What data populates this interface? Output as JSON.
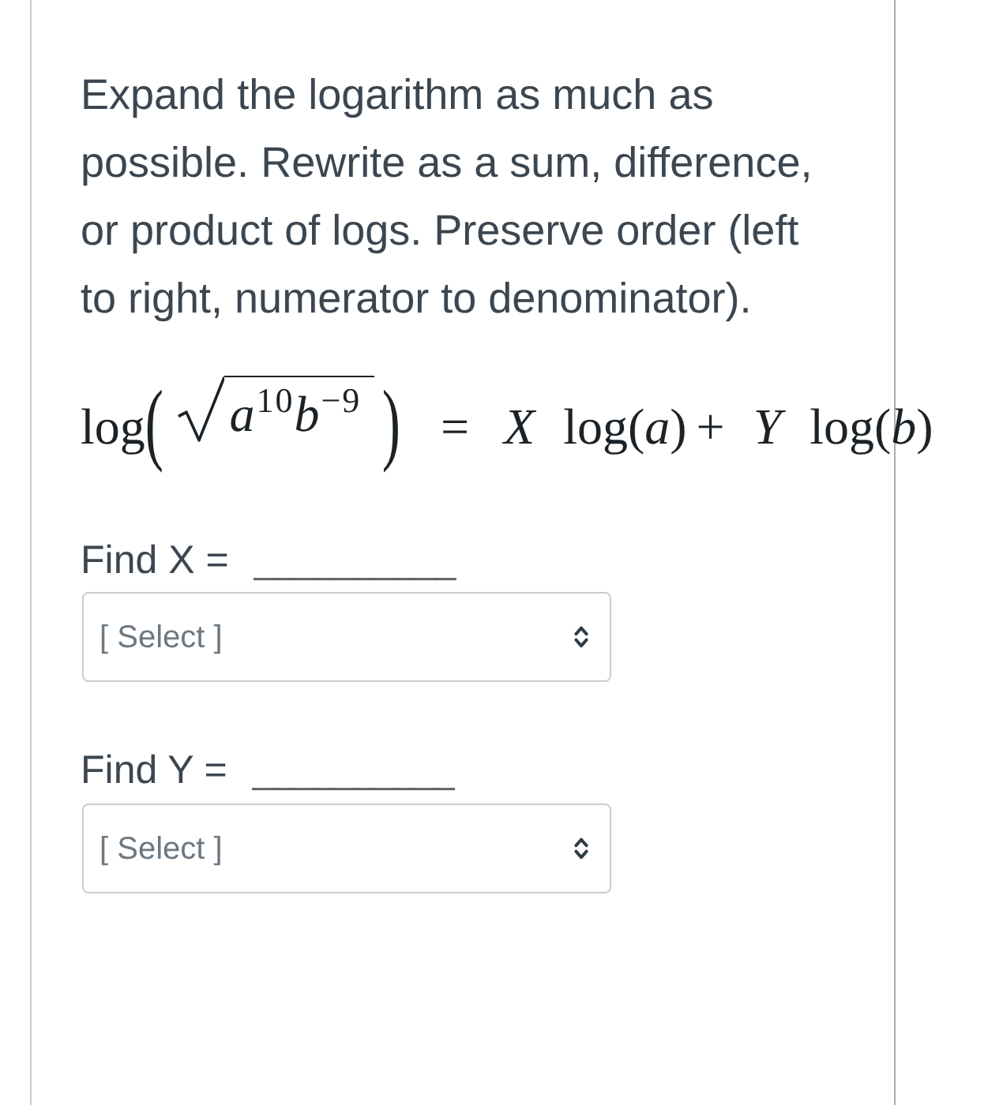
{
  "instructions": "Expand the logarithm as much as possible. Rewrite as a sum, difference, or product of logs. Preserve order (left to right, numerator to denominator).",
  "equation": {
    "function": "log",
    "delimiters": [
      "(",
      ")"
    ],
    "radicand": "*a*$^{10}$*b*$^{−9}$",
    "rhs": [
      {
        "kind": "relation",
        "text": "="
      },
      {
        "kind": "variable",
        "text": "X"
      },
      {
        "kind": "term",
        "text": "log(*a*)"
      },
      {
        "kind": "operator",
        "text": "+"
      },
      {
        "kind": "variable",
        "text": "Y"
      },
      {
        "kind": "term",
        "text": "log(*b*)"
      }
    ]
  },
  "questions": [
    {
      "label": "Find X =",
      "blank": "__________",
      "select": {
        "value": "[ Select ]"
      }
    },
    {
      "label": "Find Y =",
      "blank": "__________",
      "select": {
        "value": "[ Select ]"
      }
    }
  ]
}
